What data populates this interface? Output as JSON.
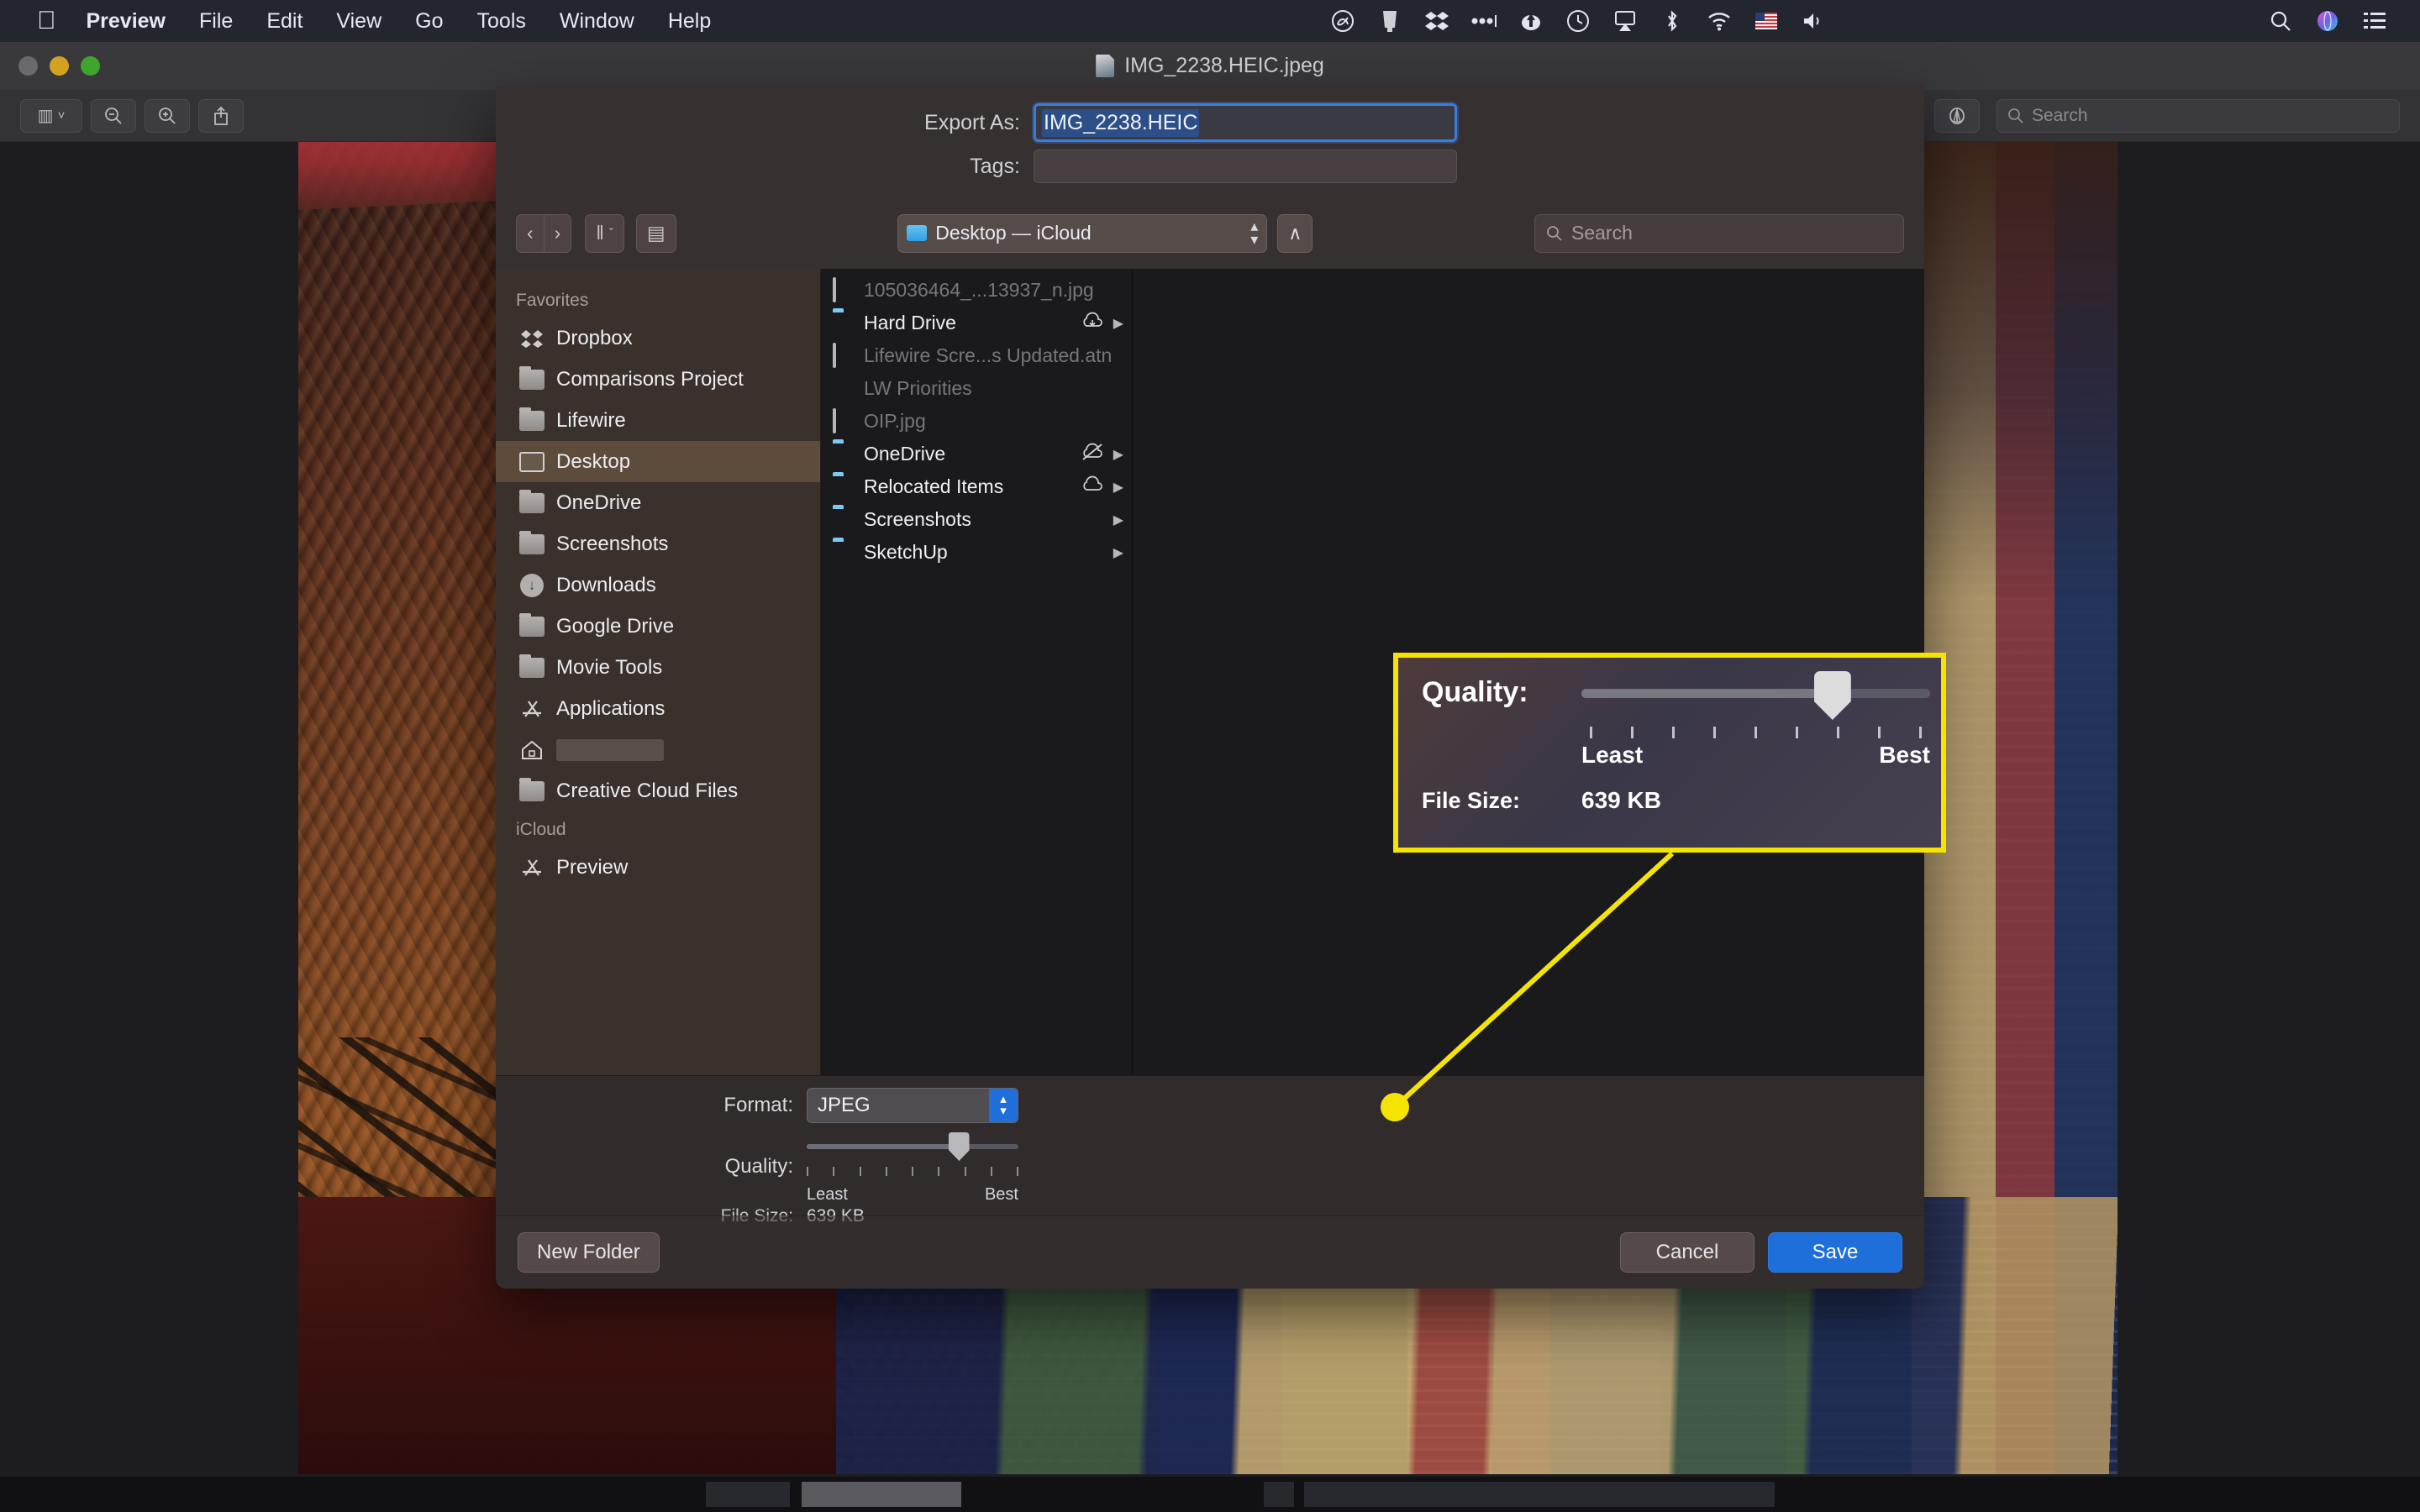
{
  "menubar": {
    "apple": "apple-logo",
    "items": [
      {
        "label": "Preview",
        "bold": true
      },
      {
        "label": "File"
      },
      {
        "label": "Edit"
      },
      {
        "label": "View"
      },
      {
        "label": "Go"
      },
      {
        "label": "Tools"
      },
      {
        "label": "Window"
      },
      {
        "label": "Help"
      }
    ],
    "status_icons": [
      "creative-cloud-icon",
      "display-icon",
      "dropbox-icon",
      "ellipsis-icon",
      "onedrive-icon",
      "time-machine-icon",
      "airplay-icon",
      "bluetooth-icon",
      "wifi-icon",
      "input-flag-icon",
      "volume-icon"
    ],
    "right_icons": [
      "spotlight-search-icon",
      "siri-icon",
      "control-center-icon"
    ]
  },
  "window": {
    "title": "IMG_2238.HEIC.jpeg",
    "title_icon": "document-icon",
    "traffic_lights": [
      "close-button",
      "minimize-button",
      "zoom-button"
    ],
    "toolbar": {
      "sidebar_label": "▥",
      "zoom_out_label": "−",
      "zoom_in_label": "+",
      "share_label": "⤴",
      "markup_label": "✎",
      "rotate_label": "↺",
      "annotate_label": "Ⓐ",
      "search_placeholder": "Search",
      "search_icon": "search-icon"
    }
  },
  "sheet": {
    "export_as": {
      "label": "Export As:",
      "value": "IMG_2238.HEIC",
      "selected": true
    },
    "tags": {
      "label": "Tags:",
      "value": ""
    },
    "nav": {
      "back_label": "‹",
      "forward_label": "›",
      "view_label": "‖",
      "view_chevron": "ˇ",
      "new_folder_icon_label": "▤",
      "location": "Desktop — iCloud",
      "location_icon": "folder-icon",
      "stepper_icon": "stepper-updown-icon",
      "up_label": "∧",
      "search_placeholder": "Search",
      "search_icon": "search-icon"
    },
    "sidebar": {
      "sections": [
        {
          "header": "Favorites",
          "items": [
            {
              "label": "Dropbox",
              "icon": "dropbox-icon",
              "active": false
            },
            {
              "label": "Comparisons Project",
              "icon": "folder-icon",
              "active": false
            },
            {
              "label": "Lifewire",
              "icon": "folder-icon",
              "active": false
            },
            {
              "label": "Desktop",
              "icon": "desktop-icon",
              "active": true
            },
            {
              "label": "OneDrive",
              "icon": "folder-icon",
              "active": false
            },
            {
              "label": "Screenshots",
              "icon": "folder-icon",
              "active": false
            },
            {
              "label": "Downloads",
              "icon": "downloads-icon",
              "active": false
            },
            {
              "label": "Google Drive",
              "icon": "folder-icon",
              "active": false
            },
            {
              "label": "Movie Tools",
              "icon": "folder-icon",
              "active": false
            },
            {
              "label": "Applications",
              "icon": "applications-icon",
              "active": false
            },
            {
              "label": "",
              "icon": "home-icon",
              "redacted": true,
              "active": false
            },
            {
              "label": "Creative Cloud Files",
              "icon": "folder-icon",
              "active": false
            }
          ]
        },
        {
          "header": "iCloud",
          "items": [
            {
              "label": "Preview",
              "icon": "applications-icon",
              "active": false
            }
          ]
        }
      ]
    },
    "files": [
      {
        "name": "105036464_...13937_n.jpg",
        "icon": "image-icon",
        "dim": true,
        "cloud": "",
        "chevron": false
      },
      {
        "name": "Hard Drive",
        "icon": "folder-icon",
        "dim": false,
        "cloud": "cloud-download-icon",
        "chevron": true
      },
      {
        "name": "Lifewire Scre...s Updated.atn",
        "icon": "action-icon",
        "dim": true,
        "cloud": "",
        "chevron": false
      },
      {
        "name": "LW Priorities",
        "icon": "document-icon",
        "dim": true,
        "cloud": "",
        "chevron": false
      },
      {
        "name": "OIP.jpg",
        "icon": "image-icon",
        "dim": true,
        "cloud": "",
        "chevron": false
      },
      {
        "name": "OneDrive",
        "icon": "folder-icon",
        "dim": false,
        "cloud": "cloud-slash-icon",
        "chevron": true
      },
      {
        "name": "Relocated Items",
        "icon": "folder-alias-icon",
        "dim": false,
        "cloud": "cloud-icon",
        "chevron": true
      },
      {
        "name": "Screenshots",
        "icon": "folder-icon",
        "dim": false,
        "cloud": "",
        "chevron": true
      },
      {
        "name": "SketchUp",
        "icon": "folder-icon",
        "dim": false,
        "cloud": "",
        "chevron": true
      }
    ],
    "format": {
      "label": "Format:",
      "value": "JPEG"
    },
    "quality": {
      "label": "Quality:",
      "least_label": "Least",
      "best_label": "Best",
      "value_percent": 72,
      "tick_count": 9
    },
    "file_size": {
      "label": "File Size:",
      "value": "639 KB"
    },
    "footer": {
      "new_folder_label": "New Folder",
      "cancel_label": "Cancel",
      "save_label": "Save"
    }
  },
  "callout": {
    "quality_label": "Quality:",
    "least_label": "Least",
    "best_label": "Best",
    "file_size_label": "File Size:",
    "file_size_value": "639 KB",
    "value_percent": 72,
    "tick_count": 9,
    "border_color": "#f5e400",
    "leader_dot_color": "#f5e400"
  },
  "colors": {
    "accent_blue": "#1e6fd9",
    "highlight_yellow": "#f5e400",
    "selection_blue": "#2b4f86",
    "sidebar_active": "#8a6c4e"
  }
}
